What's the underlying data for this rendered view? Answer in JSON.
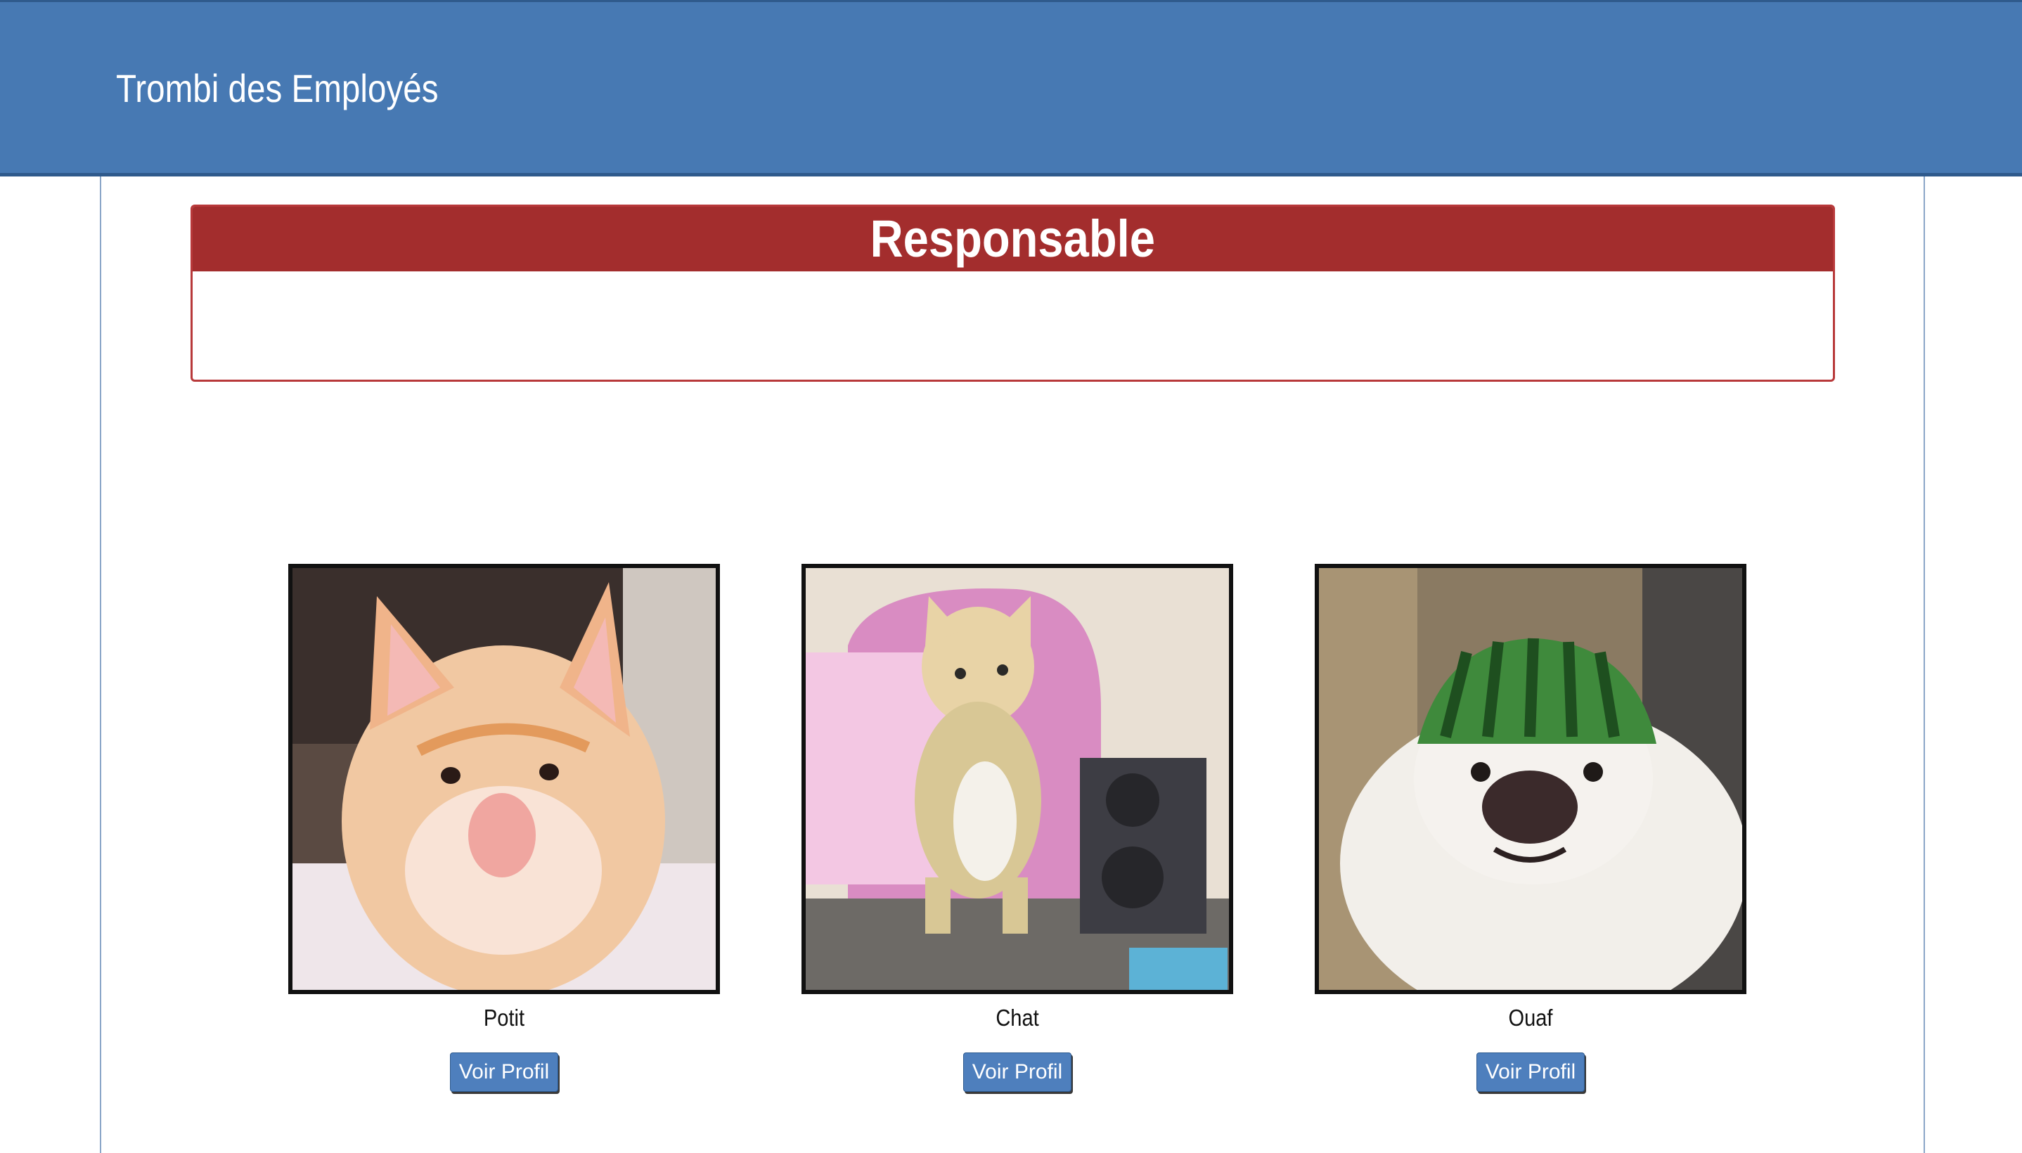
{
  "header": {
    "title": "Trombi des Employés",
    "background_color": "#4779b3"
  },
  "manager_panel": {
    "title": "Responsable",
    "header_color": "#a32d2d"
  },
  "employees": [
    {
      "name": "Potit",
      "photo_icon": "orange-cat-photo",
      "button_label": "Voir Profil"
    },
    {
      "name": "Chat",
      "photo_icon": "dancing-kitten-photo",
      "button_label": "Voir Profil"
    },
    {
      "name": "Ouaf",
      "photo_icon": "dog-with-watermelon-helmet-photo",
      "button_label": "Voir Profil"
    }
  ],
  "button_color": "#4e7fbd"
}
